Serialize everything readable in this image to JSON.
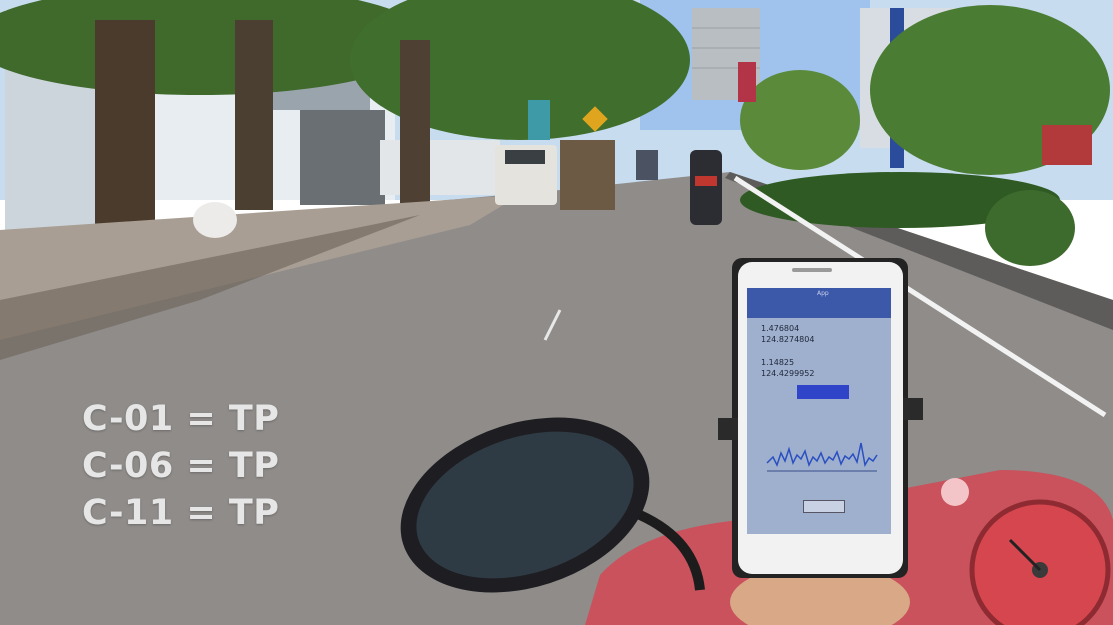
{
  "overlay": {
    "lines": [
      "C-01 = TP",
      "C-06 = TP",
      "C-11 = TP"
    ]
  },
  "phone": {
    "screen_lines": [
      "1.476804",
      "124.8274804",
      "1.14825",
      "124.4299952"
    ]
  },
  "colors": {
    "road": "#8f8c8a",
    "sky": "#bcd7ef",
    "foliage": "#3f6a2c",
    "overlay_text": "#e6e6e6",
    "phone_screen": "#9fb0cf",
    "speedometer": "#c9525c"
  }
}
